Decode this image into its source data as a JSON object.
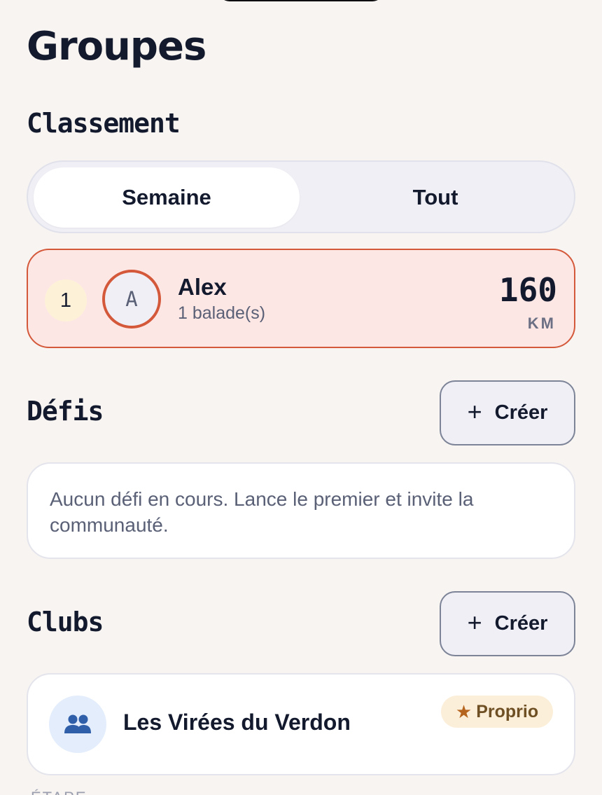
{
  "page": {
    "title": "Groupes"
  },
  "leaderboard": {
    "section_title": "Classement",
    "tabs": [
      {
        "label": "Semaine",
        "active": true
      },
      {
        "label": "Tout",
        "active": false
      }
    ],
    "entries": [
      {
        "rank": "1",
        "avatar_initial": "A",
        "name": "Alex",
        "subtitle": "1 balade(s)",
        "value": "160",
        "unit": "KM"
      }
    ]
  },
  "challenges": {
    "section_title": "Défis",
    "create_label": "Créer",
    "empty_text": "Aucun défi en cours. Lance le premier et invite la communauté."
  },
  "clubs": {
    "section_title": "Clubs",
    "create_label": "Créer",
    "items": [
      {
        "name": "Les Virées du Verdon",
        "badge": "Proprio",
        "icon": "group-icon",
        "badge_icon": "star-icon"
      }
    ],
    "next_label_partial": "ÉTAPE"
  },
  "colors": {
    "background": "#f8f4f1",
    "accent": "#d4583a",
    "highlight_bg": "#fde7e5",
    "text_primary": "#141a2e",
    "text_secondary": "#5a6076",
    "club_icon_bg": "#e3edfb",
    "club_icon": "#2f5fa8",
    "badge_bg": "#fcefd9"
  }
}
